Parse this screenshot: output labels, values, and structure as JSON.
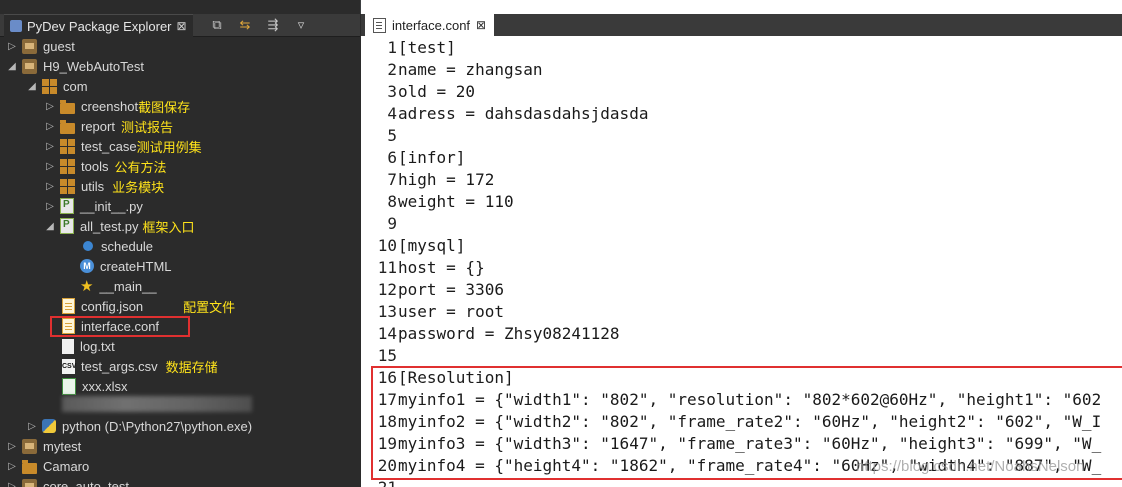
{
  "left_panel": {
    "tab_title": "PyDev Package Explorer",
    "tab_close": "⊠",
    "tools": [
      "⧉",
      "⇆",
      "⇶",
      "▿"
    ],
    "tree": [
      {
        "label": "guest",
        "note": ""
      },
      {
        "label": "H9_WebAutoTest",
        "note": ""
      },
      {
        "label": "com",
        "note": ""
      },
      {
        "label": "creenshot",
        "note": "截图保存"
      },
      {
        "label": "report",
        "note": "测试报告"
      },
      {
        "label": "test_case",
        "note": "测试用例集"
      },
      {
        "label": "tools",
        "note": "公有方法"
      },
      {
        "label": "utils",
        "note": "业务模块"
      },
      {
        "label": "__init__.py",
        "note": ""
      },
      {
        "label": "all_test.py",
        "note": "框架入口"
      },
      {
        "label": "schedule",
        "note": ""
      },
      {
        "label": "createHTML",
        "note": ""
      },
      {
        "label": "__main__",
        "note": ""
      },
      {
        "label": "config.json",
        "note": "配置文件"
      },
      {
        "label": "interface.conf",
        "note": ""
      },
      {
        "label": "log.txt",
        "note": ""
      },
      {
        "label": "test_args.csv",
        "note": "数据存储"
      },
      {
        "label": "xxx.xlsx",
        "note": ""
      },
      {
        "label": "python  (D:\\Python27\\python.exe)",
        "note": ""
      },
      {
        "label": "mytest",
        "note": ""
      },
      {
        "label": "Camaro",
        "note": ""
      },
      {
        "label": "core_auto_test",
        "note": ""
      }
    ]
  },
  "editor": {
    "tab_title": "interface.conf",
    "tab_close": "⊠",
    "lines": [
      {
        "n": "1",
        "t": "[test]"
      },
      {
        "n": "2",
        "t": "name = zhangsan"
      },
      {
        "n": "3",
        "t": "old = 20"
      },
      {
        "n": "4",
        "t": "adress = dahsdasdahsjdasda"
      },
      {
        "n": "5",
        "t": ""
      },
      {
        "n": "6",
        "t": "[infor]"
      },
      {
        "n": "7",
        "t": "high = 172"
      },
      {
        "n": "8",
        "t": "weight = 110"
      },
      {
        "n": "9",
        "t": ""
      },
      {
        "n": "10",
        "t": "[mysql]"
      },
      {
        "n": "11",
        "t": "host = {}"
      },
      {
        "n": "12",
        "t": "port = 3306"
      },
      {
        "n": "13",
        "t": "user = root"
      },
      {
        "n": "14",
        "t": "password = Zhsy08241128"
      },
      {
        "n": "15",
        "t": ""
      },
      {
        "n": "16",
        "t": "[Resolution]"
      },
      {
        "n": "17",
        "t": "myinfo1 = {\"width1\": \"802\", \"resolution\": \"802*602@60Hz\", \"height1\": \"602"
      },
      {
        "n": "18",
        "t": "myinfo2 = {\"width2\": \"802\", \"frame_rate2\": \"60Hz\", \"height2\": \"602\", \"W_I"
      },
      {
        "n": "19",
        "t": "myinfo3 = {\"width3\": \"1647\", \"frame_rate3\": \"60Hz\", \"height3\": \"699\", \"W_"
      },
      {
        "n": "20",
        "t": "myinfo4 = {\"height4\": \"1862\", \"frame_rate4\": \"60Hz\", \"width4\": \"887\", \"W_"
      },
      {
        "n": "21",
        "t": ""
      }
    ],
    "watermark": "https://blog.csdn.net/NoahsNelson"
  }
}
